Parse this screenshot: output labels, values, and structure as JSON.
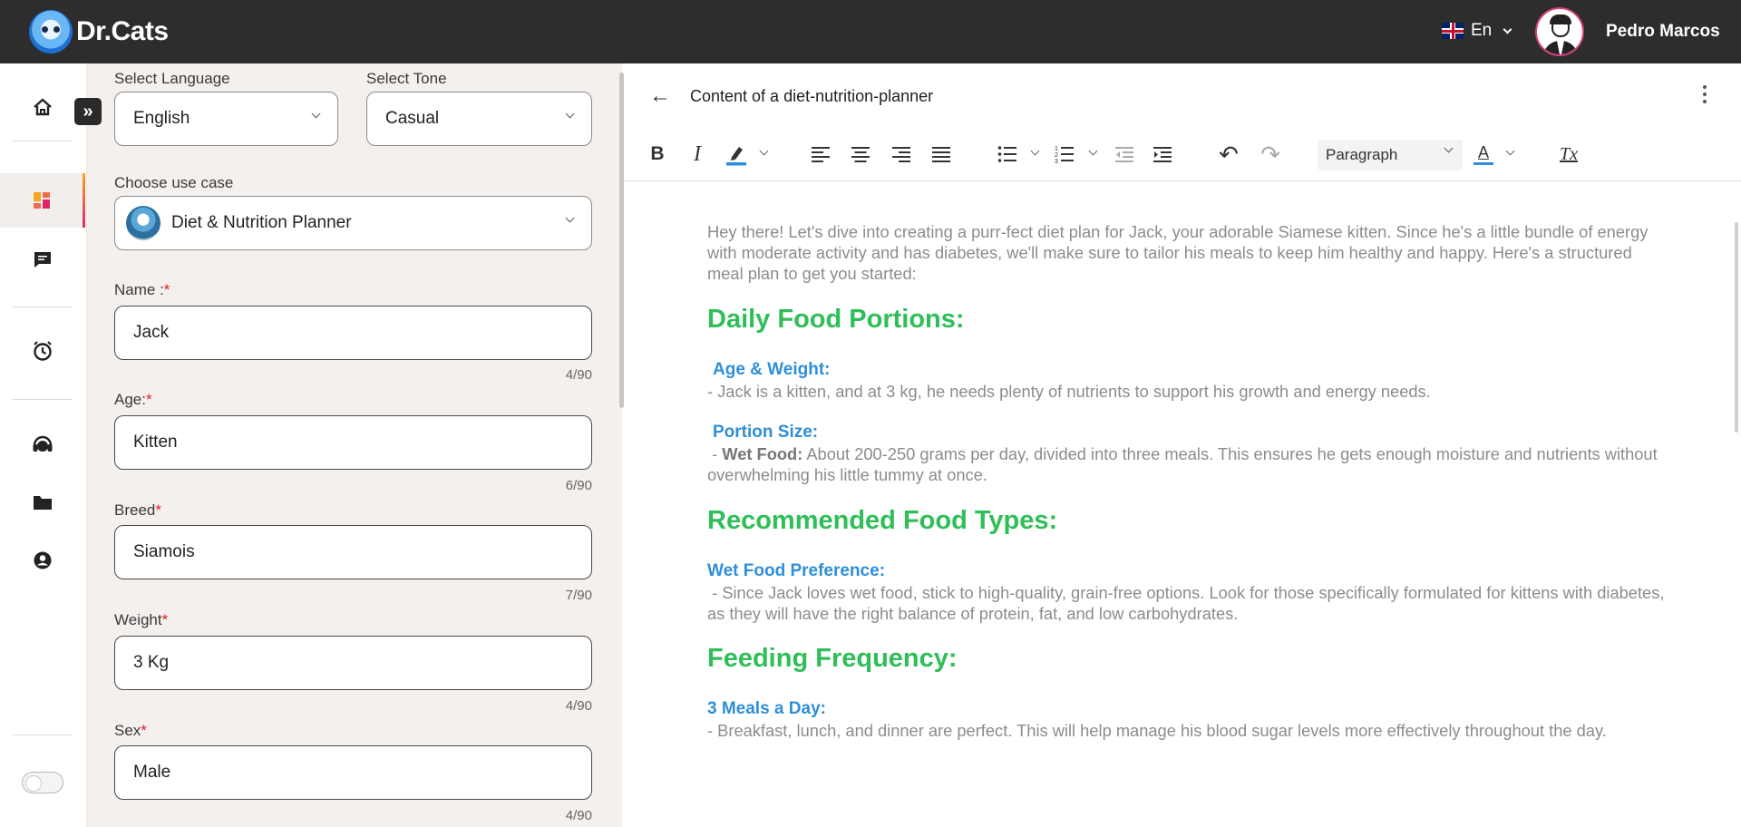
{
  "app": {
    "logo_text": "Dr.Cats",
    "language": "En",
    "user_name": "Pedro Marcos"
  },
  "rail": {
    "items": [
      "home-icon",
      "dashboard-icon",
      "chat-icon",
      "history-icon",
      "support-icon",
      "folder-icon",
      "account-icon"
    ],
    "expand_label": "»"
  },
  "form": {
    "language_label": "Select Language",
    "language_value": "English",
    "tone_label": "Select Tone",
    "tone_value": "Casual",
    "usecase_label": "Choose use case",
    "usecase_value": "Diet & Nutrition Planner",
    "fields": [
      {
        "label": "Name :",
        "value": "Jack",
        "counter": "4/90"
      },
      {
        "label": "Age:",
        "value": "Kitten",
        "counter": "6/90"
      },
      {
        "label": "Breed",
        "value": "Siamois",
        "counter": "7/90"
      },
      {
        "label": "Weight",
        "value": "3 Kg",
        "counter": "4/90"
      },
      {
        "label": "Sex",
        "value": "Male",
        "counter": "4/90"
      }
    ],
    "required_mark": "*"
  },
  "editor": {
    "title": "Content of a diet-nutrition-planner",
    "back_label": "←",
    "paragraph_style": "Paragraph",
    "toolbar": {
      "bold": "B",
      "italic": "I",
      "undo": "↶",
      "redo": "↷",
      "font_color": "A",
      "clear_format": "Tx"
    },
    "accent_colors": {
      "heading": "#2fbe57",
      "subheading": "#2e8fd8"
    }
  },
  "doc": {
    "intro": "Hey there! Let's dive into creating a purr-fect diet plan for Jack, your adorable Siamese kitten. Since he's a little bundle of energy with moderate activity and has diabetes, we'll make sure to tailor his meals to keep him healthy and happy. Here's a structured meal plan to get you started:",
    "h1": "Daily Food Portions:",
    "sub1": "Age & Weight:",
    "p1": "- Jack is a kitten, and at 3 kg, he needs plenty of nutrients to support his growth and energy needs.",
    "sub2": "Portion Size:",
    "p2_bold": "Wet Food:",
    "p2_prefix": "- ",
    "p2_rest": " About 200-250 grams per day, divided into three meals. This ensures he gets enough moisture and nutrients without overwhelming his little tummy at once.",
    "h2": "Recommended Food Types:",
    "sub3": "Wet Food Preference:",
    "p3": "- Since Jack loves wet food, stick to high-quality, grain-free options. Look for those specifically formulated for kittens with diabetes, as they will have the right balance of protein, fat, and low carbohydrates.",
    "h3": "Feeding Frequency:",
    "sub4": "3 Meals a Day:",
    "p4": "- Breakfast, lunch, and dinner are perfect. This will help manage his blood sugar levels more effectively throughout the day."
  }
}
